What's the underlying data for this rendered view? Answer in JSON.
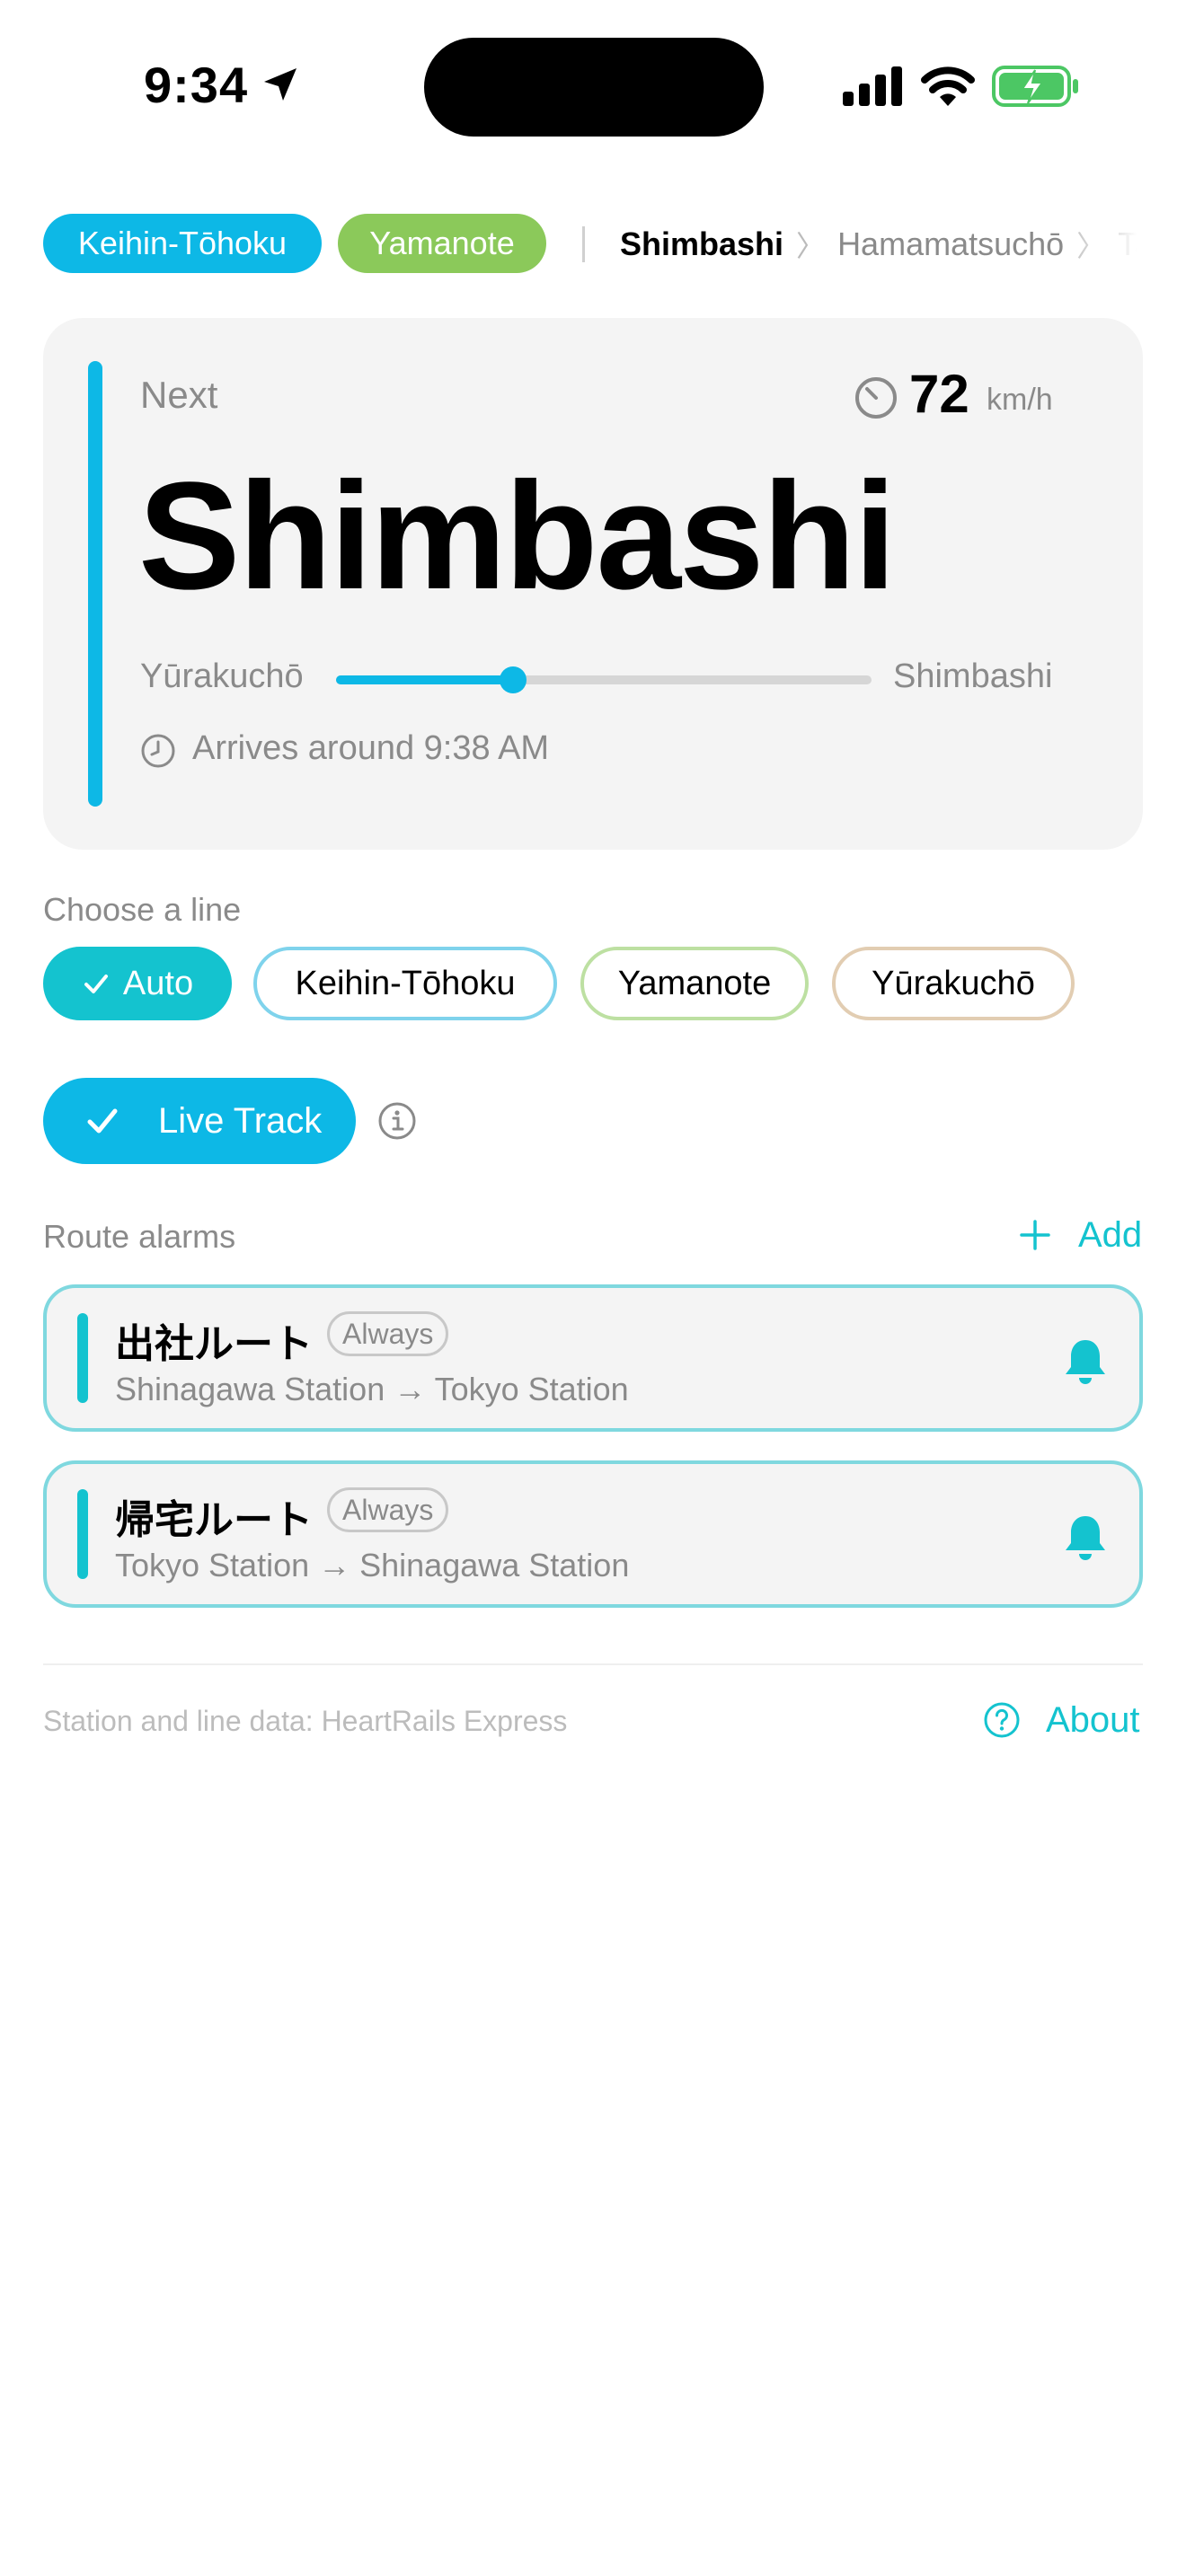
{
  "status_bar": {
    "time": "9:34",
    "icons": [
      "location-arrow-icon",
      "cellular-signal-icon",
      "wifi-icon",
      "battery-charging-icon"
    ]
  },
  "line_chips": [
    {
      "label": "Keihin-Tōhoku",
      "color": "#0db8e6"
    },
    {
      "label": "Yamanote",
      "color": "#8bc95a"
    }
  ],
  "breadcrumb": {
    "current": "Shimbashi",
    "next": "Hamamatsuchō",
    "after": "Ta"
  },
  "next_card": {
    "label": "Next",
    "speed": "72",
    "speed_unit": "km/h",
    "station": "Shimbashi",
    "from": "Yūrakuchō",
    "to": "Shimbashi",
    "progress": 0.33,
    "arrival": "Arrives around 9:38 AM",
    "accent_color": "#0db8e6"
  },
  "choose_line": {
    "label": "Choose a line",
    "options": [
      {
        "label": "Auto",
        "selected": true
      },
      {
        "label": "Keihin-Tōhoku",
        "selected": false
      },
      {
        "label": "Yamanote",
        "selected": false
      },
      {
        "label": "Yūrakuchō",
        "selected": false
      }
    ]
  },
  "live_track": {
    "label": "Live Track",
    "enabled": true
  },
  "route_alarms": {
    "label": "Route alarms",
    "add_label": "Add",
    "items": [
      {
        "name": "出社ルート",
        "badge": "Always",
        "route": "Shinagawa Station → Tokyo Station"
      },
      {
        "name": "帰宅ルート",
        "badge": "Always",
        "route": "Tokyo Station → Shinagawa Station"
      }
    ]
  },
  "footer": {
    "credit": "Station and line data: HeartRails Express",
    "about_label": "About"
  },
  "colors": {
    "accent_blue": "#0db8e6",
    "accent_teal": "#14c3cf",
    "yamanote_green": "#8bc95a"
  }
}
